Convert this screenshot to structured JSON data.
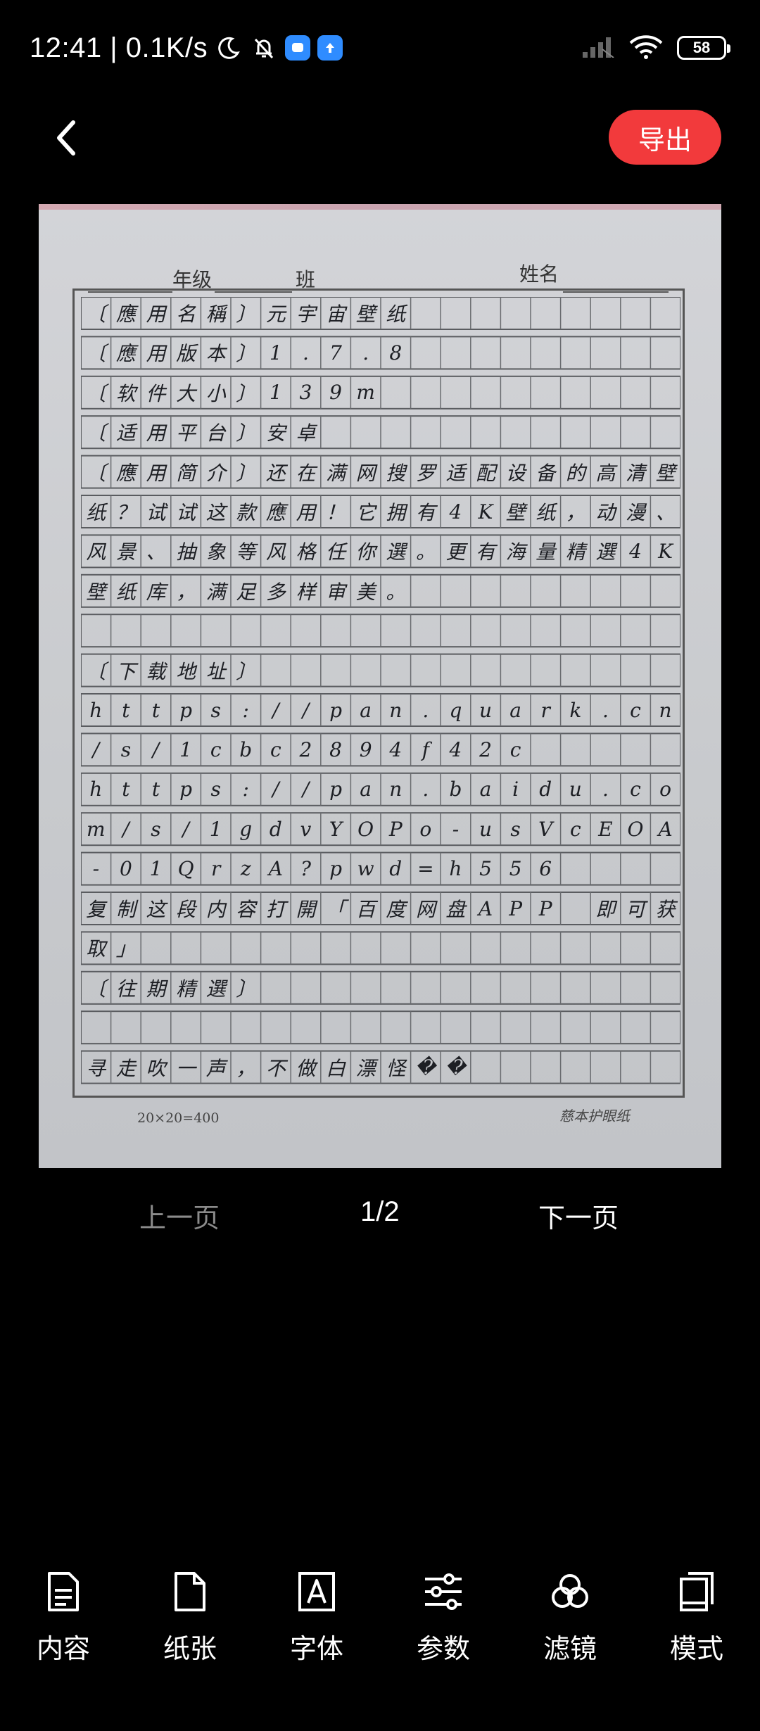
{
  "status_bar": {
    "time_speed": "12:41 | 0.1K/s",
    "battery_level": "58",
    "icons": [
      "moon-icon",
      "bell-off-icon",
      "chat-app-icon",
      "upload-app-icon",
      "signal-icon",
      "wifi-icon",
      "battery-icon"
    ]
  },
  "header": {
    "back_icon": "chevron-left-icon",
    "export_label": "导出"
  },
  "preview": {
    "header_grade": "年级",
    "header_class": "班",
    "header_name": "姓名",
    "rows": [
      "〔應用名稱〕元宇宙壁纸",
      "〔應用版本〕1.7.8",
      "〔软件大小〕139m",
      "〔适用平台〕安卓",
      "〔應用简介〕还在满网搜罗适配设备的高清壁",
      "纸？试试这款應用！它拥有4K壁纸，动漫、",
      "风景、抽象等风格任你選。更有海量精選4K",
      "壁纸库，满足多样审美。",
      "",
      "〔下载地址〕",
      "https://pan.quark.cn",
      "/s/1cbc2894f42c",
      "https://pan.baidu.co",
      "m/s/1gdvYOPo-usVcEOA",
      "-01QrzA?pwd=h556",
      "复制这段内容打開「百度网盘APP 即可获",
      "取」",
      "〔往期精選〕",
      "",
      "寻走吹一声，不做白漂怪��"
    ],
    "footer_left": "20×20=400",
    "footer_right": "慈本护眼纸"
  },
  "pager": {
    "prev_label": "上一页",
    "page_indicator": "1/2",
    "next_label": "下一页"
  },
  "toolbar": {
    "items": [
      {
        "label": "内容",
        "icon": "document-lines-icon"
      },
      {
        "label": "纸张",
        "icon": "paper-icon"
      },
      {
        "label": "字体",
        "icon": "font-a-icon"
      },
      {
        "label": "参数",
        "icon": "sliders-icon"
      },
      {
        "label": "滤镜",
        "icon": "filter-circles-icon"
      },
      {
        "label": "模式",
        "icon": "pages-icon"
      }
    ]
  }
}
